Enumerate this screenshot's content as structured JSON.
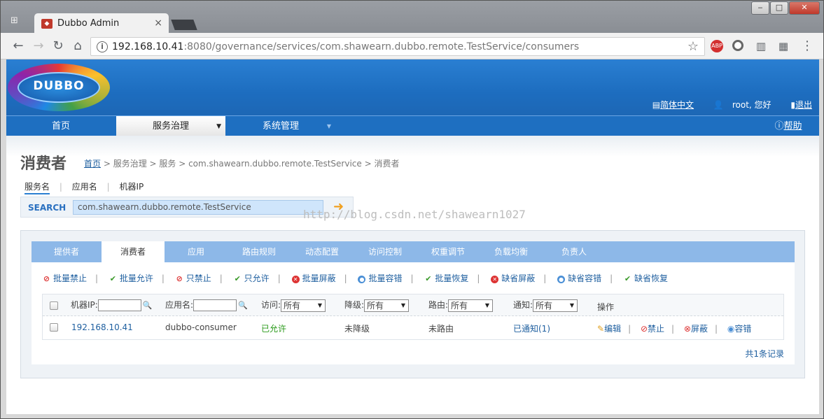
{
  "browser": {
    "tab_title": "Dubbo Admin",
    "tab_close": "×",
    "url_host": "192.168.10.41",
    "url_rest": ":8080/governance/services/com.shawearn.dubbo.remote.TestService/consumers",
    "window_controls": [
      "‒",
      "□",
      "✕"
    ],
    "ext_abp": "ABP"
  },
  "header": {
    "logo_text": "DUBBO",
    "lang_link": "简体中文",
    "greeting": "root, 您好",
    "logout": "退出",
    "help": "帮助"
  },
  "menu": [
    {
      "label": "首页"
    },
    {
      "label": "服务治理",
      "arrow": "▼"
    },
    {
      "label": "系统管理",
      "arrow": "▼"
    }
  ],
  "page": {
    "title": "消费者",
    "breadcrumb": {
      "home": "首页",
      "rest": " > 服务治理 > 服务 > com.shawearn.dubbo.remote.TestService > 消费者"
    },
    "search_tabs": [
      "服务名",
      "|",
      "应用名",
      "|",
      "机器IP"
    ],
    "search_label": "SEARCH",
    "search_value": "com.shawearn.dubbo.remote.TestService",
    "watermark": "http://blog.csdn.net/shawearn1027"
  },
  "panel_tabs": [
    "提供者",
    "消费者",
    "应用",
    "路由规则",
    "动态配置",
    "访问控制",
    "权重调节",
    "负载均衡",
    "负责人"
  ],
  "actions": [
    {
      "label": "批量禁止",
      "icon": "ban"
    },
    {
      "label": "批量允许",
      "icon": "ok"
    },
    {
      "label": "只禁止",
      "icon": "ban"
    },
    {
      "label": "只允许",
      "icon": "ok"
    },
    {
      "label": "批量屏蔽",
      "icon": "block"
    },
    {
      "label": "批量容错",
      "icon": "tol"
    },
    {
      "label": "批量恢复",
      "icon": "ok"
    },
    {
      "label": "缺省屏蔽",
      "icon": "block"
    },
    {
      "label": "缺省容错",
      "icon": "tol"
    },
    {
      "label": "缺省恢复",
      "icon": "ok"
    }
  ],
  "table": {
    "headers": {
      "ip": "机器IP:",
      "app": "应用名:",
      "access": "访问:",
      "degrade": "降级:",
      "route": "路由:",
      "notify": "通知:",
      "ops": "操作"
    },
    "filter_all": "所有",
    "rows": [
      {
        "ip": "192.168.10.41",
        "app": "dubbo-consumer",
        "access": "已允许",
        "degrade": "未降级",
        "route": "未路由",
        "notify": "已通知(1)",
        "ops": [
          "编辑",
          "禁止",
          "屏蔽",
          "容错"
        ]
      }
    ],
    "count": "共1条记录"
  }
}
